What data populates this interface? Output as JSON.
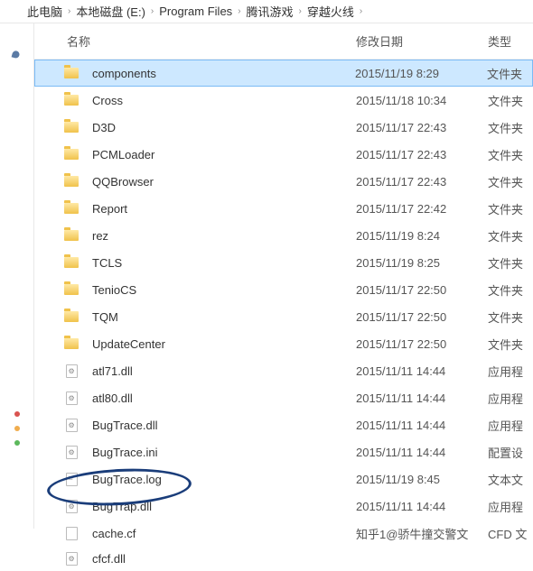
{
  "breadcrumb": [
    "此电脑",
    "本地磁盘 (E:)",
    "Program Files",
    "腾讯游戏",
    "穿越火线"
  ],
  "headers": {
    "name": "名称",
    "date": "修改日期",
    "type": "类型"
  },
  "files": [
    {
      "name": "components",
      "date": "2015/11/19 8:29",
      "type": "文件夹",
      "icon": "folder",
      "selected": true
    },
    {
      "name": "Cross",
      "date": "2015/11/18 10:34",
      "type": "文件夹",
      "icon": "folder"
    },
    {
      "name": "D3D",
      "date": "2015/11/17 22:43",
      "type": "文件夹",
      "icon": "folder"
    },
    {
      "name": "PCMLoader",
      "date": "2015/11/17 22:43",
      "type": "文件夹",
      "icon": "folder"
    },
    {
      "name": "QQBrowser",
      "date": "2015/11/17 22:43",
      "type": "文件夹",
      "icon": "folder"
    },
    {
      "name": "Report",
      "date": "2015/11/17 22:42",
      "type": "文件夹",
      "icon": "folder"
    },
    {
      "name": "rez",
      "date": "2015/11/19 8:24",
      "type": "文件夹",
      "icon": "folder"
    },
    {
      "name": "TCLS",
      "date": "2015/11/19 8:25",
      "type": "文件夹",
      "icon": "folder"
    },
    {
      "name": "TenioCS",
      "date": "2015/11/17 22:50",
      "type": "文件夹",
      "icon": "folder"
    },
    {
      "name": "TQM",
      "date": "2015/11/17 22:50",
      "type": "文件夹",
      "icon": "folder"
    },
    {
      "name": "UpdateCenter",
      "date": "2015/11/17 22:50",
      "type": "文件夹",
      "icon": "folder"
    },
    {
      "name": "atl71.dll",
      "date": "2015/11/11 14:44",
      "type": "应用程",
      "icon": "gear"
    },
    {
      "name": "atl80.dll",
      "date": "2015/11/11 14:44",
      "type": "应用程",
      "icon": "gear"
    },
    {
      "name": "BugTrace.dll",
      "date": "2015/11/11 14:44",
      "type": "应用程",
      "icon": "gear"
    },
    {
      "name": "BugTrace.ini",
      "date": "2015/11/11 14:44",
      "type": "配置设",
      "icon": "config"
    },
    {
      "name": "BugTrace.log",
      "date": "2015/11/19 8:45",
      "type": "文本文",
      "icon": "text"
    },
    {
      "name": "BugTrap.dll",
      "date": "2015/11/11 14:44",
      "type": "应用程",
      "icon": "gear",
      "annotated": true
    },
    {
      "name": "cache.cf",
      "date": "知乎1@骄牛撞交警文",
      "type": "CFD 文",
      "icon": "file"
    },
    {
      "name": "cfcf.dll",
      "date": "",
      "type": "",
      "icon": "gear"
    }
  ]
}
